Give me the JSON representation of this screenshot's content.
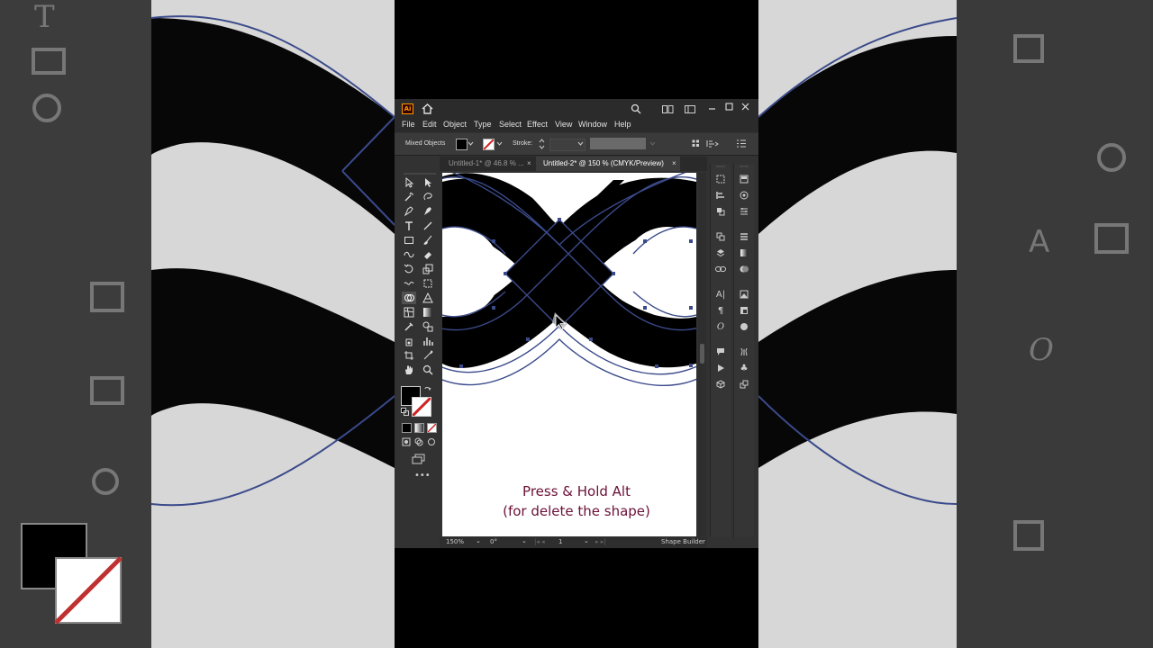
{
  "app": {
    "logo": "Ai"
  },
  "menu": [
    "File",
    "Edit",
    "Object",
    "Type",
    "Select",
    "Effect",
    "View",
    "Window",
    "Help"
  ],
  "control_bar": {
    "selection_label": "Mixed Objects",
    "stroke_label": "Stroke:"
  },
  "tabs": [
    {
      "label": "Untitled-1* @ 46.8 % ...",
      "active": false
    },
    {
      "label": "Untitled-2* @ 150 % (CMYK/Preview)",
      "active": true
    }
  ],
  "status": {
    "zoom": "150%",
    "rotation": "0°",
    "artboard": "1",
    "tool": "Shape Builder"
  },
  "caption": {
    "line1": "Press & Hold Alt",
    "line2": "(for delete the shape)"
  },
  "colors": {
    "caption": "#6b1038",
    "path": "#3a4a8a",
    "app_bg": "#323232"
  }
}
